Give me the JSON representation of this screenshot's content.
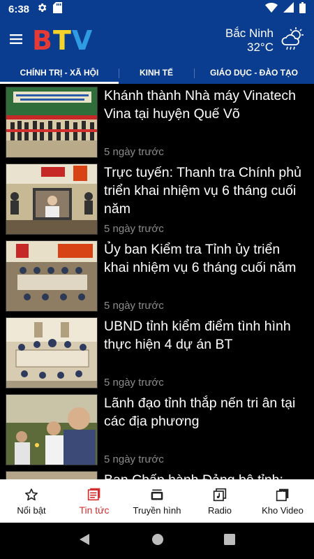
{
  "status_bar": {
    "time": "6:38"
  },
  "header": {
    "logo": {
      "b": "B",
      "t": "T",
      "v": "V"
    },
    "weather": {
      "city": "Bắc Ninh",
      "temp": "32°C",
      "icon": "partly-cloudy-rain-icon"
    }
  },
  "tabs": [
    {
      "label": "CHÍNH TRỊ - XÃ HỘI",
      "active": true
    },
    {
      "label": "KINH TẾ",
      "active": false
    },
    {
      "label": "GIÁO DỤC - ĐÀO TẠO",
      "active": false
    }
  ],
  "news": [
    {
      "title": "Khánh thành Nhà máy Vinatech Vina tại huyện Quế Võ",
      "time": "5 ngày trước"
    },
    {
      "title": "Trực tuyến: Thanh tra Chính phủ triển khai nhiệm vụ 6 tháng cuối năm",
      "time": "5 ngày trước"
    },
    {
      "title": "Ủy ban Kiểm tra Tỉnh ủy triển khai nhiệm vụ 6 tháng cuối năm",
      "time": "5 ngày trước"
    },
    {
      "title": "UBND tỉnh kiểm điểm tình hình thực hiện 4 dự án BT",
      "time": "5 ngày trước"
    },
    {
      "title": "Lãnh đạo tỉnh thắp nến tri ân tại các địa phương",
      "time": "5 ngày trước"
    },
    {
      "title": "Ban Chấp hành Đảng bộ tỉnh:",
      "time": ""
    }
  ],
  "bottom_nav": [
    {
      "label": "Nổi bật",
      "icon": "star-icon",
      "active": false
    },
    {
      "label": "Tin tức",
      "icon": "news-icon",
      "active": true
    },
    {
      "label": "Truyền hình",
      "icon": "tv-icon",
      "active": false
    },
    {
      "label": "Radio",
      "icon": "radio-icon",
      "active": false
    },
    {
      "label": "Kho Video",
      "icon": "video-library-icon",
      "active": false
    }
  ],
  "colors": {
    "header_bg": "#0a3d8f",
    "active_nav": "#d32f2f",
    "time_gray": "#8c8c8c"
  }
}
